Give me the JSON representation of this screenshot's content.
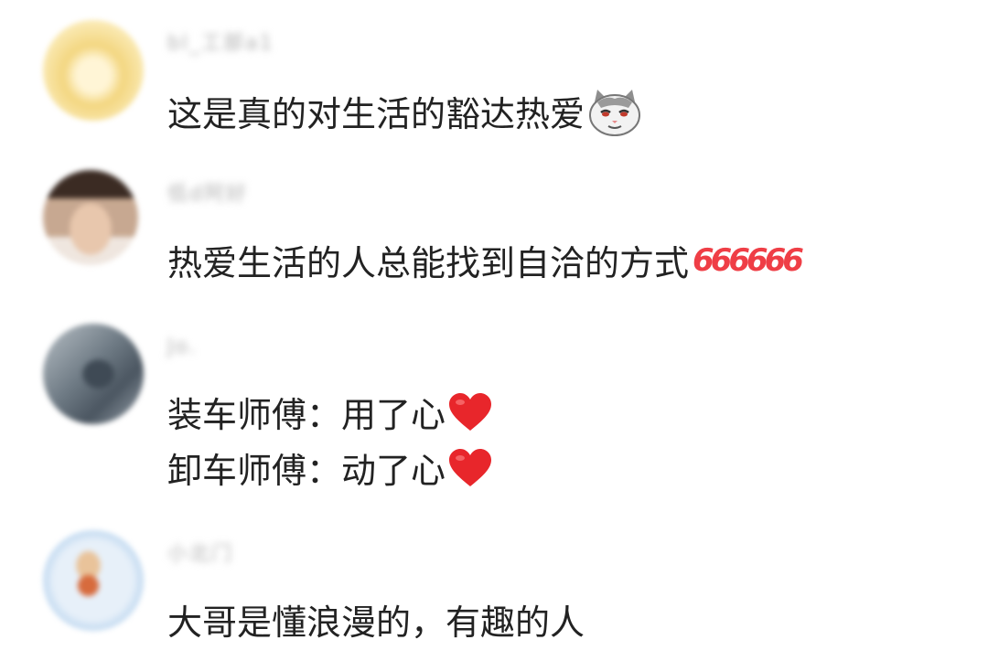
{
  "comments": [
    {
      "username": "bl_工部a1",
      "text": "这是真的对生活的豁达热爱",
      "emoji": "cat-face-emoji",
      "colors": {
        "avatar_bg": "#f6dc8a",
        "avatar_accent": "#fff3c4"
      }
    },
    {
      "username": "低d阿好",
      "text": "热爱生活的人总能找到自洽的方式",
      "emoji": "666-emoji",
      "emoji_text": "666666",
      "colors": {
        "avatar_bg": "#c9b09a",
        "avatar_accent": "#3a2a22"
      }
    },
    {
      "username": "Jo.",
      "lines": [
        "装车师傅：用了心",
        "卸车师傅：动了心"
      ],
      "emoji": "red-heart-emoji",
      "colors": {
        "avatar_bg": "#7d8892",
        "avatar_accent": "#44505c"
      }
    },
    {
      "username": "小北门",
      "text": "大哥是懂浪漫的，有趣的人",
      "colors": {
        "avatar_bg": "#cfe3f5",
        "avatar_accent": "#d76b3d"
      }
    }
  ],
  "colors": {
    "text": "#222222",
    "username": "#b0b0b0",
    "heart": "#e8262b",
    "six": "#ef3e46"
  }
}
